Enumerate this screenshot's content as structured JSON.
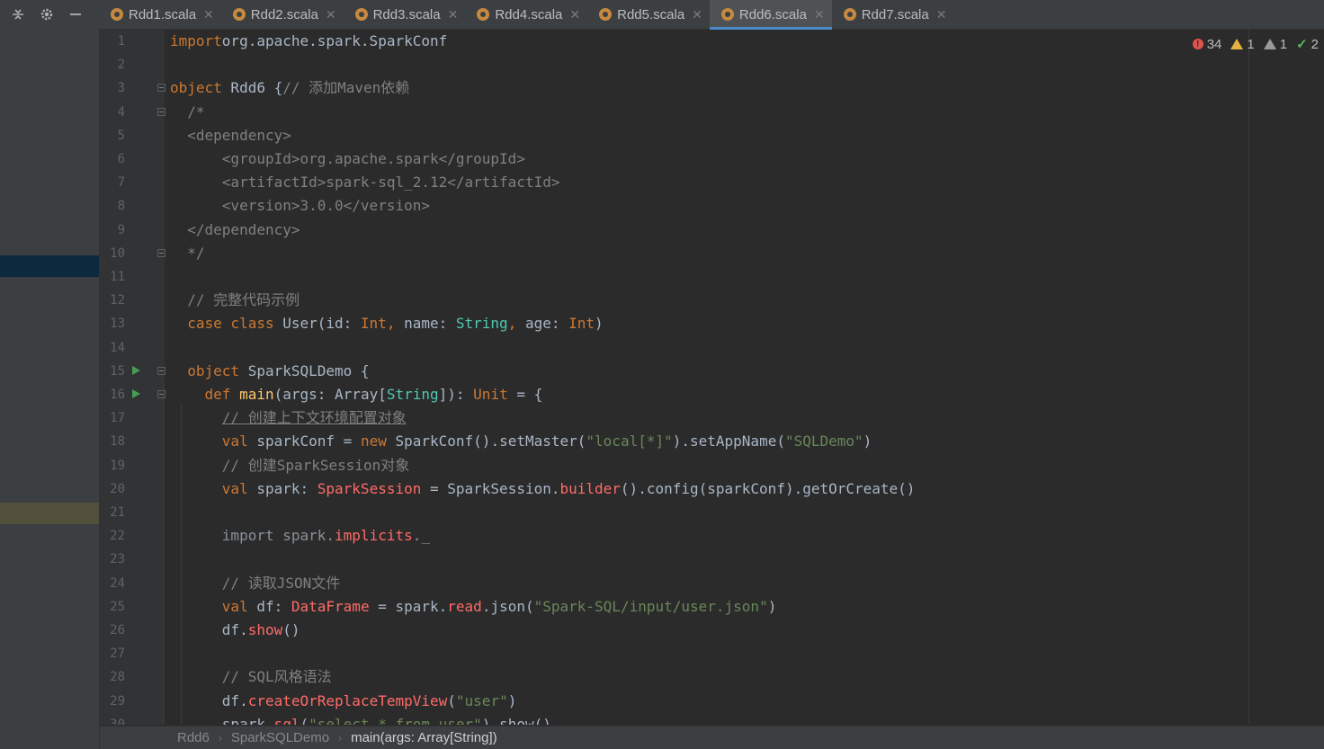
{
  "tabs": [
    {
      "label": "Rdd1.scala",
      "active": false
    },
    {
      "label": "Rdd2.scala",
      "active": false
    },
    {
      "label": "Rdd3.scala",
      "active": false
    },
    {
      "label": "Rdd4.scala",
      "active": false
    },
    {
      "label": "Rdd5.scala",
      "active": false
    },
    {
      "label": "Rdd6.scala",
      "active": true
    },
    {
      "label": "Rdd7.scala",
      "active": false
    }
  ],
  "inspections": {
    "errors": "34",
    "warnings": "1",
    "weak_warnings": "1",
    "ok": "2"
  },
  "breadcrumb": [
    "Rdd6",
    "SparkSQLDemo",
    "main(args: Array[String])"
  ],
  "lines": [
    {
      "n": "1",
      "t": [
        [
          "kw",
          "import"
        ],
        [
          "",
          "org.apache.spark.SparkConf"
        ]
      ]
    },
    {
      "n": "2",
      "t": []
    },
    {
      "n": "3",
      "fold": true,
      "t": [
        [
          "kw",
          "object"
        ],
        [
          "",
          " Rdd6 {"
        ],
        [
          "cm",
          "// 添加Maven依赖"
        ]
      ]
    },
    {
      "n": "4",
      "fold": true,
      "t": [
        [
          "cm",
          "  /*"
        ]
      ]
    },
    {
      "n": "5",
      "t": [
        [
          "cm",
          "  <dependency>"
        ]
      ]
    },
    {
      "n": "6",
      "t": [
        [
          "cm",
          "      <groupId>org.apache.spark</groupId>"
        ]
      ]
    },
    {
      "n": "7",
      "t": [
        [
          "cm",
          "      <artifactId>spark-sql_2.12</artifactId>"
        ]
      ]
    },
    {
      "n": "8",
      "t": [
        [
          "cm",
          "      <version>3.0.0</version>"
        ]
      ]
    },
    {
      "n": "9",
      "t": [
        [
          "cm",
          "  </dependency>"
        ]
      ]
    },
    {
      "n": "10",
      "fold": true,
      "t": [
        [
          "cm",
          "  */"
        ]
      ]
    },
    {
      "n": "11",
      "t": []
    },
    {
      "n": "12",
      "t": [
        [
          "cm",
          "  // 完整代码示例"
        ]
      ]
    },
    {
      "n": "13",
      "t": [
        [
          "",
          "  "
        ],
        [
          "kw",
          "case class"
        ],
        [
          "",
          " User(id: "
        ],
        [
          "kw",
          "Int,"
        ],
        [
          "",
          " name: "
        ],
        [
          "type",
          "String"
        ],
        [
          "kw",
          ","
        ],
        [
          "",
          " age: "
        ],
        [
          "kw",
          "Int"
        ],
        [
          "",
          ")"
        ]
      ]
    },
    {
      "n": "14",
      "t": []
    },
    {
      "n": "15",
      "run": true,
      "fold": true,
      "t": [
        [
          "",
          "  "
        ],
        [
          "kw",
          "object"
        ],
        [
          "",
          " SparkSQLDemo {"
        ]
      ]
    },
    {
      "n": "16",
      "run": true,
      "fold": true,
      "t": [
        [
          "",
          "    "
        ],
        [
          "kw",
          "def"
        ],
        [
          "fn",
          " main"
        ],
        [
          "",
          "(args: Array["
        ],
        [
          "type",
          "String"
        ],
        [
          "",
          "]): "
        ],
        [
          "kw",
          "Unit"
        ],
        [
          "",
          " = {"
        ]
      ]
    },
    {
      "n": "17",
      "t": [
        [
          "",
          "      "
        ],
        [
          "cmu",
          "// 创建上下文环境配置对象"
        ]
      ]
    },
    {
      "n": "18",
      "t": [
        [
          "",
          "      "
        ],
        [
          "kw",
          "val"
        ],
        [
          "",
          " sparkConf = "
        ],
        [
          "kw",
          "new"
        ],
        [
          "",
          " SparkConf().setMaster("
        ],
        [
          "str",
          "\"local[*]\""
        ],
        [
          "",
          ").setAppName("
        ],
        [
          "str",
          "\"SQLDemo\""
        ],
        [
          "",
          ")"
        ]
      ]
    },
    {
      "n": "19",
      "t": [
        [
          "",
          "      "
        ],
        [
          "cm",
          "// 创建SparkSession对象"
        ]
      ]
    },
    {
      "n": "20",
      "t": [
        [
          "",
          "      "
        ],
        [
          "kw",
          "val"
        ],
        [
          "",
          " spark: "
        ],
        [
          "red",
          "SparkSession"
        ],
        [
          "",
          " = SparkSession."
        ],
        [
          "red",
          "builder"
        ],
        [
          "",
          "().config(sparkConf).getOrCreate()"
        ]
      ]
    },
    {
      "n": "21",
      "t": []
    },
    {
      "n": "22",
      "t": [
        [
          "",
          "      "
        ],
        [
          "dim",
          "import spark."
        ],
        [
          "red",
          "implicits"
        ],
        [
          "dim",
          "._"
        ]
      ]
    },
    {
      "n": "23",
      "t": []
    },
    {
      "n": "24",
      "t": [
        [
          "",
          "      "
        ],
        [
          "cm",
          "// 读取JSON文件"
        ]
      ]
    },
    {
      "n": "25",
      "t": [
        [
          "",
          "      "
        ],
        [
          "kw",
          "val"
        ],
        [
          "",
          " df: "
        ],
        [
          "red",
          "DataFrame"
        ],
        [
          "",
          " = spark."
        ],
        [
          "red",
          "read"
        ],
        [
          "",
          ".json("
        ],
        [
          "str",
          "\"Spark-SQL/input/user.json\""
        ],
        [
          "",
          ")"
        ]
      ]
    },
    {
      "n": "26",
      "t": [
        [
          "",
          "      df."
        ],
        [
          "red",
          "show"
        ],
        [
          "",
          "()"
        ]
      ]
    },
    {
      "n": "27",
      "t": []
    },
    {
      "n": "28",
      "t": [
        [
          "",
          "      "
        ],
        [
          "cm",
          "// SQL风格语法"
        ]
      ]
    },
    {
      "n": "29",
      "t": [
        [
          "",
          "      df."
        ],
        [
          "red",
          "createOrReplaceTempView"
        ],
        [
          "",
          "("
        ],
        [
          "str",
          "\"user\""
        ],
        [
          "",
          ")"
        ]
      ]
    },
    {
      "n": "30",
      "t": [
        [
          "",
          "      spark."
        ],
        [
          "red",
          "sql"
        ],
        [
          "",
          "("
        ],
        [
          "str",
          "\"select * from user\""
        ],
        [
          "",
          ").show()"
        ]
      ]
    }
  ]
}
